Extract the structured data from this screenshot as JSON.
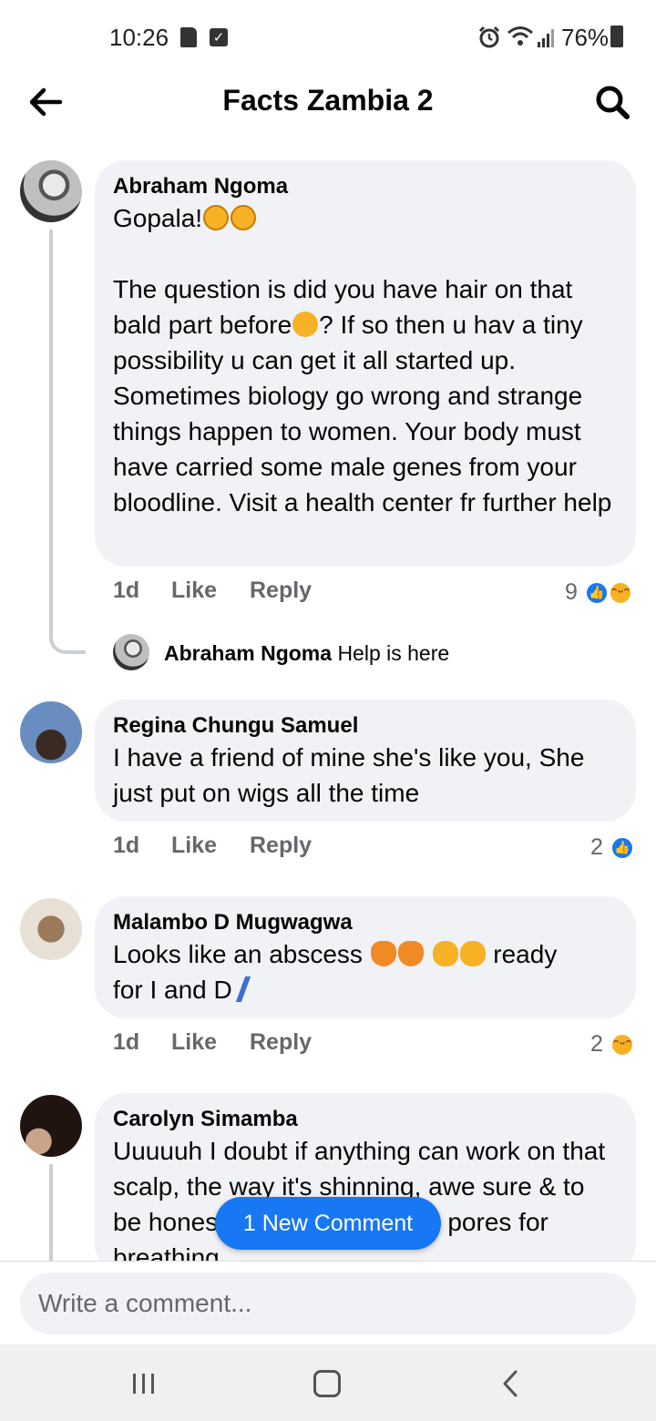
{
  "status_bar": {
    "time": "10:26",
    "battery": "76%",
    "icons": [
      "sd-card-icon",
      "check-icon",
      "alarm-icon",
      "wifi-icon",
      "signal-icon",
      "battery-icon"
    ]
  },
  "header": {
    "title": "Facts Zambia 2",
    "back_icon": "back-arrow-icon",
    "search_icon": "search-icon"
  },
  "comments": [
    {
      "author": "Abraham Ngoma",
      "text_start": "Gopala!",
      "text_rest": "The question is did you have hair on that bald part before",
      "text_rest2": "? If so then u hav a tiny possibility u can  get it all started up.  Sometimes biology go wrong and strange things happen to women. Your body must have carried some male genes from your bloodline. Visit a health center fr further help",
      "time": "1d",
      "like": "Like",
      "reply": "Reply",
      "reaction_count": "9",
      "reactions": [
        "like",
        "haha"
      ]
    },
    {
      "author": "Regina Chungu Samuel",
      "text": "I have a friend of mine she's like you, She just put on wigs all the time",
      "time": "1d",
      "like": "Like",
      "reply": "Reply",
      "reaction_count": "2",
      "reactions": [
        "like"
      ]
    },
    {
      "author": "Malambo D Mugwagwa",
      "text_start": "Looks like an abscess",
      "text_mid": "ready",
      "text_end": "for I and D",
      "time": "1d",
      "like": "Like",
      "reply": "Reply",
      "reaction_count": "2",
      "reactions": [
        "haha"
      ]
    },
    {
      "author": "Carolyn Simamba",
      "text": "Uuuuuh I doubt if anything can work on that scalp, the way it's shinning, awe sure & to be honest of course it has no pores for breathing"
    }
  ],
  "reply_preview": {
    "author": "Abraham Ngoma",
    "text": "Help is here"
  },
  "new_comment_pill": "1 New Comment",
  "composer": {
    "placeholder": "Write a comment..."
  },
  "colors": {
    "accent": "#1877f2",
    "bubble": "#f0f2f5",
    "meta": "#65676b"
  }
}
